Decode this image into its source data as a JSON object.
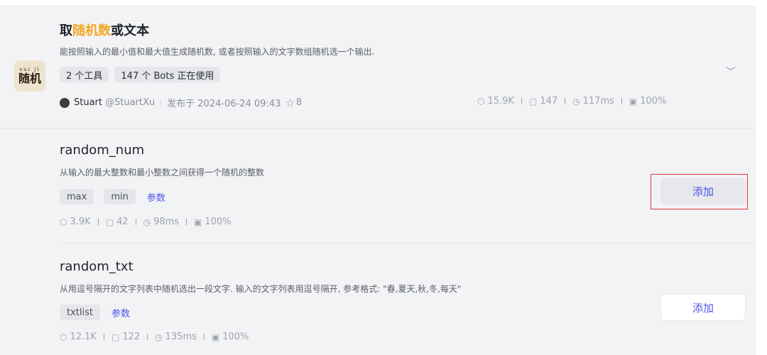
{
  "plugin": {
    "logo_pinyin": "suí  jī",
    "logo_text": "随机",
    "title_prefix": "取",
    "title_highlight": "随机数",
    "title_suffix": "或文本",
    "description": "能按照输入的最小值和最大值生成随机数, 或者按照输入的文字数组随机选一个输出.",
    "tags": [
      "2 个工具",
      "147 个 Bots 正在使用"
    ],
    "author": "Stuart",
    "handle": "@StuartXu",
    "published": "发布于 2024-06-24 09:43",
    "stars": "8",
    "stats": {
      "runs": "15.9K",
      "bots": "147",
      "latency": "117ms",
      "success": "100%"
    }
  },
  "tools": [
    {
      "name": "random_num",
      "description": "从输入的最大整数和最小整数之间获得一个随机的整数",
      "params": [
        "max",
        "min"
      ],
      "params_link": "参数",
      "stats": {
        "runs": "3.9K",
        "bots": "42",
        "latency": "98ms",
        "success": "100%"
      },
      "add_label": "添加"
    },
    {
      "name": "random_txt",
      "description": "从用逗号隔开的文字列表中随机选出一段文字. 输入的文字列表用逗号隔开, 参考格式: \"春,夏天,秋,冬,每天\"",
      "params": [
        "txtlist"
      ],
      "params_link": "参数",
      "stats": {
        "runs": "12.1K",
        "bots": "122",
        "latency": "135ms",
        "success": "100%"
      },
      "add_label": "添加"
    }
  ],
  "icons": {
    "runs": "cube-icon",
    "bots": "bot-icon",
    "latency": "clock-icon",
    "success": "success-rate-icon",
    "star": "star-icon",
    "expand": "chevron-down-icon"
  },
  "colors": {
    "accent": "#4d53e8",
    "highlight_title": "#f5a623",
    "highlight_box": "#e03838"
  }
}
